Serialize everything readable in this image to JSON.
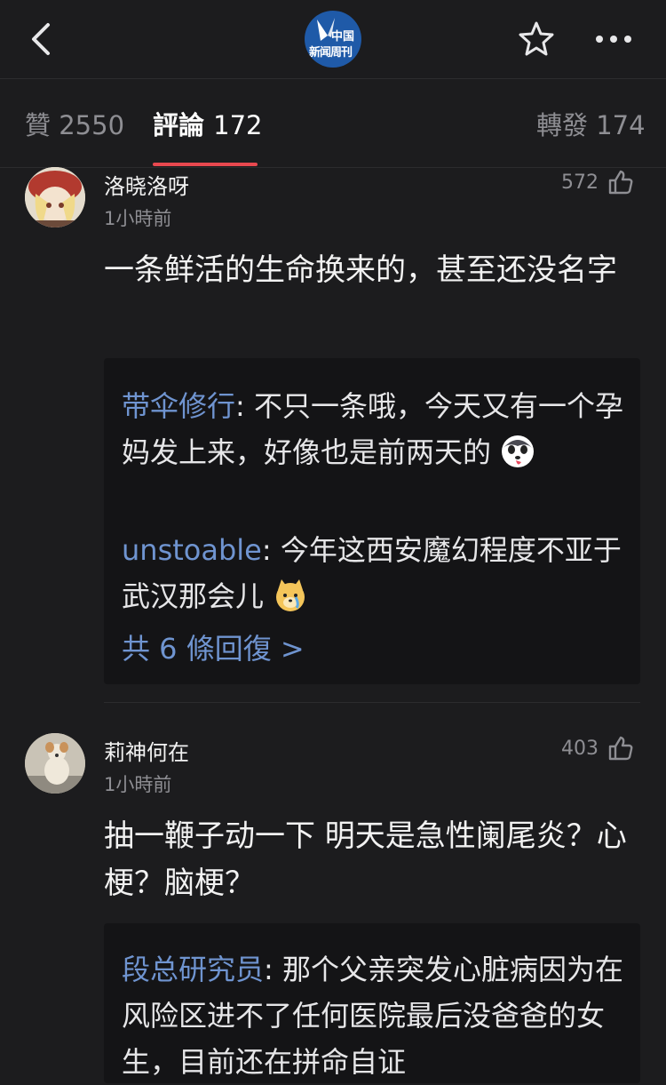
{
  "header": {
    "logo_line1": "中国",
    "logo_line2": "新闻周刊",
    "back_icon": "chevron-left-icon",
    "star_icon": "star-outline-icon",
    "more_icon": "more-horizontal-icon"
  },
  "tabs": {
    "likes_label": "贊",
    "likes_count": "2550",
    "comments_label": "評論",
    "comments_count": "172",
    "reposts_label": "轉發",
    "reposts_count": "174"
  },
  "comments": [
    {
      "user": "洛晓洛呀",
      "time": "1小時前",
      "likes": "572",
      "text": "一条鲜活的生命换来的，甚至还没名字",
      "replies": [
        {
          "user": "带伞修行",
          "text": "不只一条哦，今天又有一个孕妈发上来，好像也是前两天的",
          "emoji": "husky-face-icon"
        },
        {
          "user": "unstoable",
          "text": "今年这西安魔幻程度不亚于武汉那会儿",
          "emoji": "crying-doge-icon"
        }
      ],
      "more_replies": "共 6 條回復 >"
    },
    {
      "user": "莉神何在",
      "time": "1小時前",
      "likes": "403",
      "text": "抽一鞭子动一下 明天是急性阑尾炎？心梗？脑梗？",
      "replies": [
        {
          "user": "段总研究员",
          "text": "那个父亲突发心脏病因为在风险区进不了任何医院最后没爸爸的女生，目前还在拼命自证"
        }
      ]
    }
  ],
  "colors": {
    "background": "#1c1c1e",
    "accent_underline": "#e8484f",
    "reply_name": "#6f94d0",
    "logo_blue": "#1f5aa8"
  }
}
